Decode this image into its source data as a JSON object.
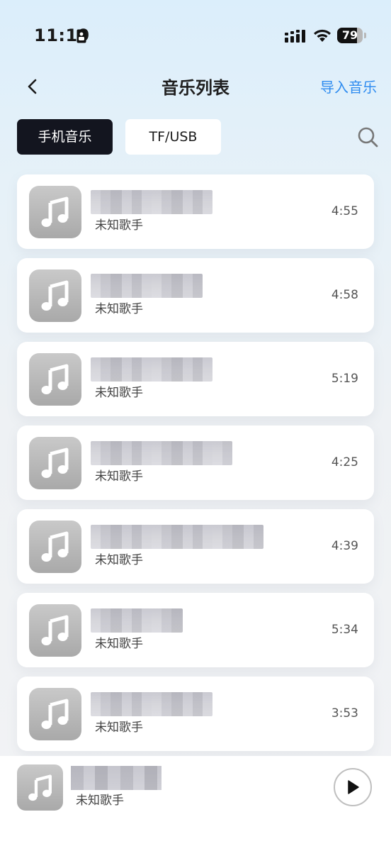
{
  "status_bar": {
    "time": "11:19",
    "battery": "79",
    "battery_level": 0.79
  },
  "nav": {
    "title": "音乐列表",
    "import_label": "导入音乐"
  },
  "tabs": [
    {
      "label": "手机音乐",
      "active": true
    },
    {
      "label": "TF/USB",
      "active": false
    }
  ],
  "songs": [
    {
      "artist": "未知歌手",
      "duration": "4:55"
    },
    {
      "artist": "未知歌手",
      "duration": "4:58"
    },
    {
      "artist": "未知歌手",
      "duration": "5:19"
    },
    {
      "artist": "未知歌手",
      "duration": "4:25"
    },
    {
      "artist": "未知歌手",
      "duration": "4:39"
    },
    {
      "artist": "未知歌手",
      "duration": "5:34"
    },
    {
      "artist": "未知歌手",
      "duration": "3:53"
    }
  ],
  "player": {
    "artist": "未知歌手"
  },
  "icons": {
    "back": "chevron-left-icon",
    "search": "search-icon",
    "music_note": "music-note-icon",
    "play": "play-icon"
  },
  "colors": {
    "accent": "#2f8cf0",
    "active_tab": "#13151f"
  }
}
